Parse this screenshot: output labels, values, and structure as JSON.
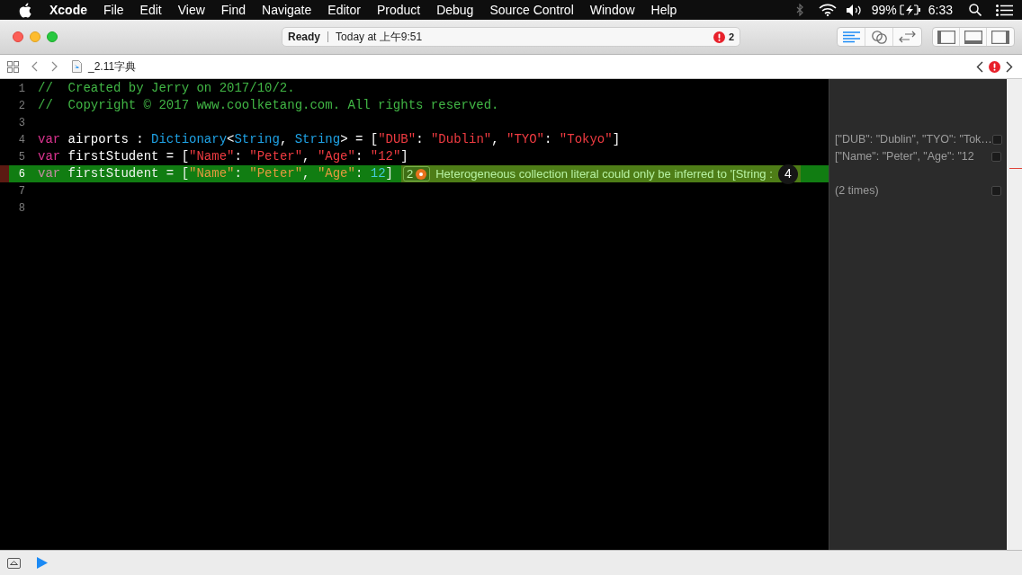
{
  "menu_bar": {
    "app": "Xcode",
    "menus": [
      "File",
      "Edit",
      "View",
      "Find",
      "Navigate",
      "Editor",
      "Product",
      "Debug",
      "Source Control",
      "Window",
      "Help"
    ],
    "battery": "99%",
    "clock": "6:33"
  },
  "toolbar": {
    "status": "Ready",
    "timestamp": "Today at 上午9:51",
    "issue_count": "2",
    "editor_modes": [
      {
        "kind": "standard",
        "selected": true
      },
      {
        "kind": "assistant",
        "selected": false
      },
      {
        "kind": "version",
        "selected": false
      }
    ],
    "panels": [
      {
        "kind": "navigator",
        "on": false
      },
      {
        "kind": "debug",
        "on": false
      },
      {
        "kind": "utilities",
        "on": false
      }
    ]
  },
  "jump_bar": {
    "file": "_2.11字典"
  },
  "editor": {
    "lines": [
      {
        "number": "1",
        "highlighted": false,
        "tokens": [
          {
            "kind": "comment",
            "text": "//  Created by Jerry on 2017/10/2."
          }
        ]
      },
      {
        "number": "2",
        "highlighted": false,
        "tokens": [
          {
            "kind": "comment",
            "text": "//  Copyright © 2017 www.coolketang.com. All rights reserved."
          }
        ]
      },
      {
        "number": "3",
        "highlighted": false
      },
      {
        "number": "4",
        "highlighted": false,
        "tokens": [
          {
            "kind": "keyword",
            "text": "var"
          },
          {
            "kind": "plain",
            "text": " airports : "
          },
          {
            "kind": "type",
            "text": "Dictionary"
          },
          {
            "kind": "plain",
            "text": "<"
          },
          {
            "kind": "type",
            "text": "String"
          },
          {
            "kind": "plain",
            "text": ", "
          },
          {
            "kind": "type",
            "text": "String"
          },
          {
            "kind": "plain",
            "text": "> = ["
          },
          {
            "kind": "string",
            "text": "\"DUB\""
          },
          {
            "kind": "plain",
            "text": ": "
          },
          {
            "kind": "string",
            "text": "\"Dublin\""
          },
          {
            "kind": "plain",
            "text": ", "
          },
          {
            "kind": "string",
            "text": "\"TYO\""
          },
          {
            "kind": "plain",
            "text": ": "
          },
          {
            "kind": "string",
            "text": "\"Tokyo\""
          },
          {
            "kind": "plain",
            "text": "]"
          }
        ],
        "result": "[\"DUB\": \"Dublin\", \"TYO\": \"Tok…"
      },
      {
        "number": "5",
        "highlighted": false,
        "tokens": [
          {
            "kind": "keyword",
            "text": "var"
          },
          {
            "kind": "plain",
            "text": " firstStudent = ["
          },
          {
            "kind": "string",
            "text": "\"Name\""
          },
          {
            "kind": "plain",
            "text": ": "
          },
          {
            "kind": "string",
            "text": "\"Peter\""
          },
          {
            "kind": "plain",
            "text": ", "
          },
          {
            "kind": "string",
            "text": "\"Age\""
          },
          {
            "kind": "plain",
            "text": ": "
          },
          {
            "kind": "string",
            "text": "\"12\""
          },
          {
            "kind": "plain",
            "text": "]"
          }
        ],
        "result": "[\"Name\": \"Peter\", \"Age\": \"12"
      },
      {
        "number": "6",
        "highlighted": true,
        "tokens": [
          {
            "kind": "keyword",
            "text": "var"
          },
          {
            "kind": "plain",
            "text": " firstStudent = ["
          },
          {
            "kind": "string",
            "text": "\"Name\""
          },
          {
            "kind": "plain",
            "text": ": "
          },
          {
            "kind": "string",
            "text": "\"Peter\""
          },
          {
            "kind": "plain",
            "text": ", "
          },
          {
            "kind": "string",
            "text": "\"Age\""
          },
          {
            "kind": "plain",
            "text": ": "
          },
          {
            "kind": "number",
            "text": "12"
          },
          {
            "kind": "plain",
            "text": "]"
          }
        ],
        "issue": {
          "count": "2",
          "message": "Heterogeneous collection literal could only be inferred to '[String :",
          "badge": "4"
        }
      },
      {
        "number": "7",
        "highlighted": false,
        "result": "(2 times)"
      },
      {
        "number": "8",
        "highlighted": false
      }
    ]
  }
}
